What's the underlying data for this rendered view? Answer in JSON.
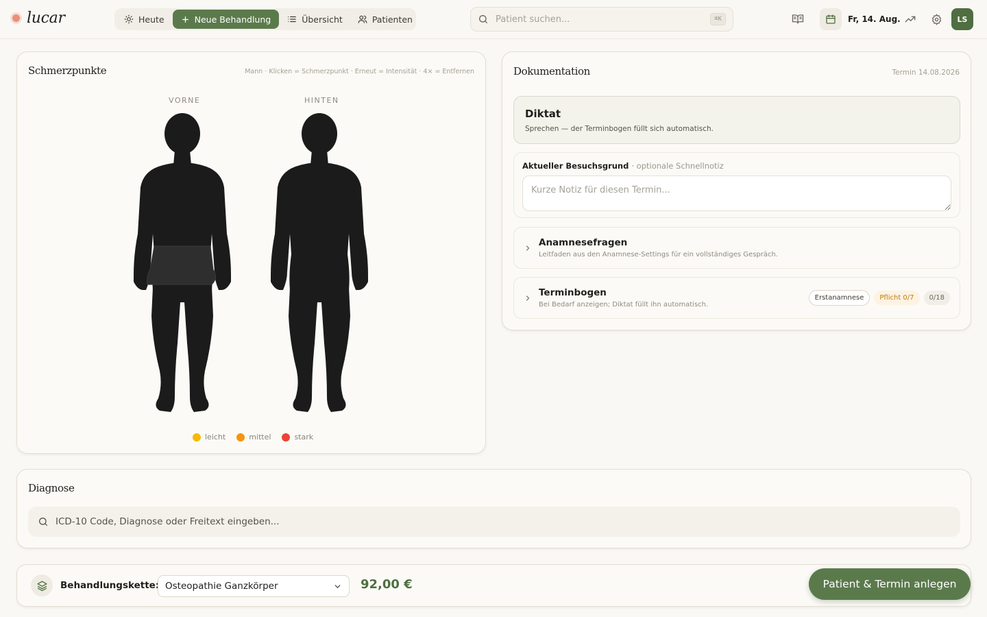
{
  "app": {
    "logo": "lucar"
  },
  "nav": {
    "items": [
      {
        "label": "Heute",
        "icon": "sun-icon"
      },
      {
        "label": "Neue Behandlung",
        "icon": "plus-icon",
        "active": true
      },
      {
        "label": "Übersicht",
        "icon": "list-icon"
      },
      {
        "label": "Patienten",
        "icon": "users-icon"
      }
    ]
  },
  "search": {
    "placeholder": "Patient suchen...",
    "shortcut": "⌘K"
  },
  "header": {
    "date": "Fr, 14. Aug.",
    "avatar_initials": "LS"
  },
  "pain_map": {
    "title": "Schmerzpunkte",
    "hint": "Mann · Klicken = Schmerzpunkt · Erneut = Intensität · 4× = Entfernen",
    "front_label": "VORNE",
    "back_label": "HINTEN",
    "legend": [
      {
        "label": "leicht",
        "color": "#f6b90a"
      },
      {
        "label": "mittel",
        "color": "#f59412"
      },
      {
        "label": "stark",
        "color": "#ec4436"
      }
    ]
  },
  "documentation": {
    "title": "Dokumentation",
    "appointment": "Termin 14.08.2026",
    "diktat": {
      "title": "Diktat",
      "subtitle": "Sprechen — der Terminbogen füllt sich automatisch."
    },
    "reason": {
      "label": "Aktueller Besuchsgrund",
      "label_hint": "· optionale Schnellnotiz",
      "placeholder": "Kurze Notiz für diesen Termin..."
    },
    "anamnese": {
      "title": "Anamnesefragen",
      "subtitle": "Leitfaden aus den Anamnese-Settings für ein vollständiges Gespräch."
    },
    "terminbogen": {
      "title": "Terminbogen",
      "subtitle": "Bei Bedarf anzeigen; Diktat füllt ihn automatisch.",
      "badge_type": "Erstanamnese",
      "badge_required": "Pflicht 0/7",
      "badge_total": "0/18"
    }
  },
  "diagnosis": {
    "title": "Diagnose",
    "placeholder": "ICD-10 Code, Diagnose oder Freitext eingeben..."
  },
  "treatment": {
    "label": "Behandlungskette:",
    "selected": "Osteopathie Ganzkörper",
    "price": "92,00 €",
    "cta": "Patient & Termin anlegen"
  },
  "colors": {
    "accent": "#5b7a4c",
    "avatar": "#4f6e41",
    "warning": "#c2790f"
  }
}
